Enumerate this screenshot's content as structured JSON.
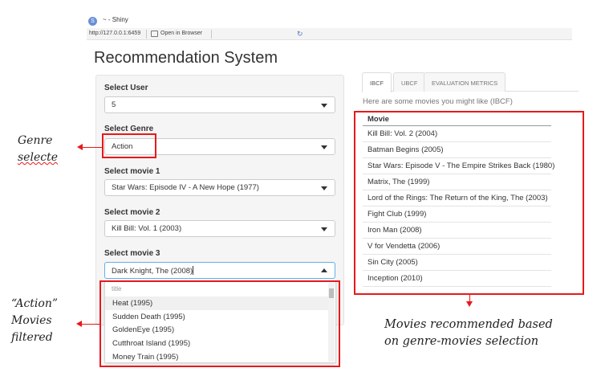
{
  "window": {
    "app_icon_text": "S",
    "title": "~ - Shiny",
    "url": "http://127.0.0.1:6459",
    "open_in_browser": "Open in Browser"
  },
  "app": {
    "title": "Recommendation System"
  },
  "sidebar": {
    "user": {
      "label": "Select User",
      "value": "5"
    },
    "genre": {
      "label": "Select Genre",
      "value": "Action"
    },
    "movie1": {
      "label": "Select movie 1",
      "value": "Star Wars: Episode IV - A New Hope (1977)"
    },
    "movie2": {
      "label": "Select movie 2",
      "value": "Kill Bill: Vol. 1 (2003)"
    },
    "movie3": {
      "label": "Select movie 3",
      "value": "Dark Knight, The (2008)"
    }
  },
  "dropdown": {
    "header": "title",
    "items": [
      "Heat (1995)",
      "Sudden Death (1995)",
      "GoldenEye (1995)",
      "Cutthroat Island (1995)",
      "Money Train (1995)"
    ]
  },
  "tabs": [
    "IBCF",
    "UBCF",
    "EVALUATION METRICS"
  ],
  "main": {
    "heading": "Here are some movies you might like (IBCF)",
    "column_header": "Movie",
    "movies": [
      "Kill Bill: Vol. 2 (2004)",
      "Batman Begins (2005)",
      "Star Wars: Episode V - The Empire Strikes Back (1980)",
      "Matrix, The (1999)",
      "Lord of the Rings: The Return of the King, The (2003)",
      "Fight Club (1999)",
      "Iron Man (2008)",
      "V for Vendetta (2006)",
      "Sin City (2005)",
      "Inception (2010)"
    ]
  },
  "annotations": {
    "genre_line1": "Genre",
    "genre_line2": "selecte",
    "action_line1": "“Action”",
    "action_line2": "Movies",
    "action_line3": "filtered",
    "rec_line1": "Movies recommended based",
    "rec_line2": "on genre-movies selection"
  },
  "colors": {
    "annotation_red": "#e8191b",
    "focus_blue": "#66afe9"
  }
}
